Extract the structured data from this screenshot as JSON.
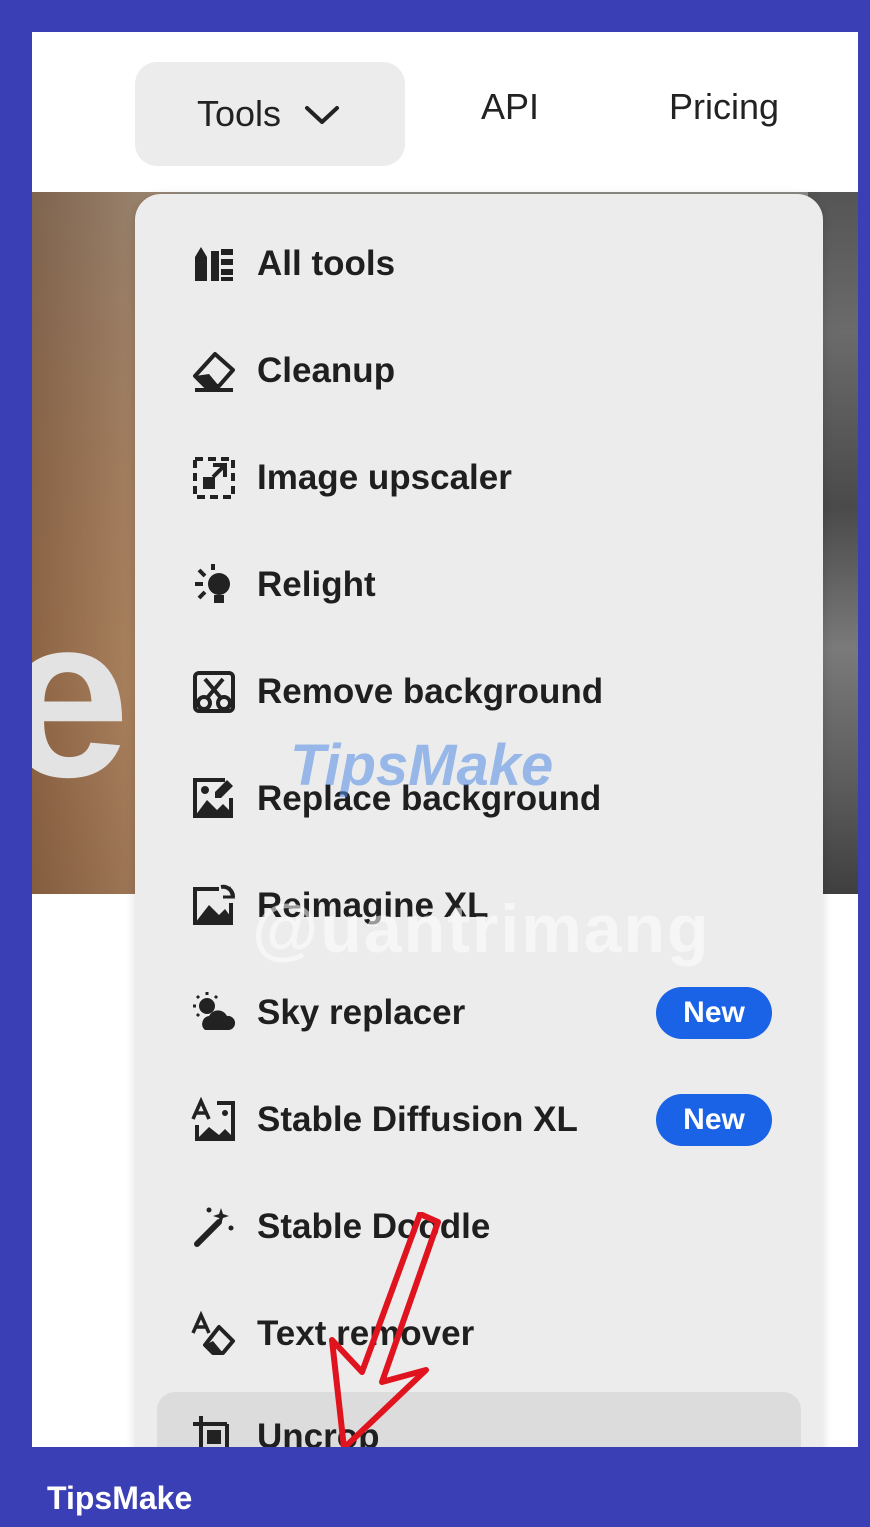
{
  "nav": {
    "tools_label": "Tools",
    "api_label": "API",
    "pricing_label": "Pricing"
  },
  "hero": {
    "letter": "e"
  },
  "menu": {
    "items": [
      {
        "label": "All tools",
        "icon": "all-tools-icon"
      },
      {
        "label": "Cleanup",
        "icon": "eraser-icon"
      },
      {
        "label": "Image upscaler",
        "icon": "upscale-icon"
      },
      {
        "label": "Relight",
        "icon": "lightbulb-icon"
      },
      {
        "label": "Remove background",
        "icon": "scissors-icon"
      },
      {
        "label": "Replace background",
        "icon": "image-replace-icon"
      },
      {
        "label": "Reimagine XL",
        "icon": "reimagine-icon"
      },
      {
        "label": "Sky replacer",
        "icon": "sky-icon",
        "badge": "New"
      },
      {
        "label": "Stable Diffusion XL",
        "icon": "text-to-image-icon",
        "badge": "New"
      },
      {
        "label": "Stable Doodle",
        "icon": "magic-wand-icon"
      },
      {
        "label": "Text remover",
        "icon": "text-eraser-icon"
      },
      {
        "label": "Uncrop",
        "icon": "uncrop-icon"
      }
    ]
  },
  "watermarks": {
    "primary": "TipsMake",
    "secondary": "@uantrimang"
  },
  "footer": {
    "brand": "TipsMake"
  },
  "colors": {
    "frame": "#3a3fb5",
    "badge": "#1a62e6",
    "menu_bg": "#ececec",
    "arrow": "#e0141e"
  }
}
